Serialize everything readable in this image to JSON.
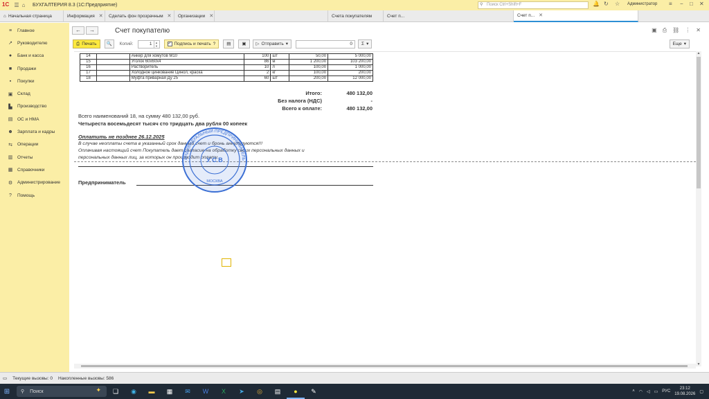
{
  "app": {
    "logo_text": "1С",
    "title": "БУХГАЛТЕРИЯ 8.3  (1С:Предприятие)",
    "search_placeholder": "Поиск Ctrl+Shift+F",
    "notifications_count": "1",
    "user": "Администратор"
  },
  "tabs": [
    {
      "label": "Начальная страница",
      "closable": false
    },
    {
      "label": "Информация",
      "closable": true
    },
    {
      "label": "Сделать фон прозрачным",
      "closable": true
    },
    {
      "label": "Организации",
      "closable": true
    },
    {
      "label": "",
      "closable": false
    },
    {
      "label": "Счета покупателям",
      "closable": false
    },
    {
      "label": "Счет п...",
      "closable": false
    },
    {
      "label": "",
      "closable": false
    },
    {
      "label": "Счет п...",
      "closable": true
    }
  ],
  "sidebar": {
    "items": [
      {
        "label": "Главное",
        "icon": "menu-icon"
      },
      {
        "label": "Руководителю",
        "icon": "chart-icon"
      },
      {
        "label": "Банк и касса",
        "icon": "bank-icon"
      },
      {
        "label": "Продажи",
        "icon": "cart-icon"
      },
      {
        "label": "Покупки",
        "icon": "basket-icon"
      },
      {
        "label": "Склад",
        "icon": "box-icon"
      },
      {
        "label": "Производство",
        "icon": "factory-icon"
      },
      {
        "label": "ОС и НМА",
        "icon": "building-icon"
      },
      {
        "label": "Зарплата и кадры",
        "icon": "people-icon"
      },
      {
        "label": "Операции",
        "icon": "operations-icon"
      },
      {
        "label": "Отчеты",
        "icon": "report-icon"
      },
      {
        "label": "Справочники",
        "icon": "book-icon"
      },
      {
        "label": "Администрирование",
        "icon": "gear-icon"
      },
      {
        "label": "Помощь",
        "icon": "help-icon"
      }
    ]
  },
  "document": {
    "title": "Счет покупателю",
    "toolbar": {
      "print_label": "Печать",
      "copies_label": "Копий:",
      "copies_value": "1",
      "sign_label": "Подпись и печать",
      "sign_checked": true,
      "send_label": "Отправить",
      "sum_value": "0",
      "more_label": "Еще"
    },
    "rows": [
      {
        "n": "14",
        "name": "Анкер для хомутов М10",
        "qty": "100",
        "unit": "шт",
        "price": "50,00",
        "total": "5 000,00"
      },
      {
        "n": "15",
        "name": "Уголок 60х60х4",
        "qty": "86",
        "unit": "м",
        "price": "1 200,00",
        "total": "103 200,00"
      },
      {
        "n": "16",
        "name": "Растворитель",
        "qty": "10",
        "unit": "л",
        "price": "100,00",
        "total": "1 000,00"
      },
      {
        "n": "17",
        "name": "Холодное цинкование Цинол, краска",
        "qty": "2",
        "unit": "кг",
        "price": "100,00",
        "total": "200,00"
      },
      {
        "n": "18",
        "name": "Муфта приварная Ду 25",
        "qty": "60",
        "unit": "шт",
        "price": "200,00",
        "total": "12 000,00"
      }
    ],
    "totals": {
      "itogo_label": "Итого:",
      "itogo_value": "480 132,00",
      "nds_label": "Без налога (НДС)",
      "nds_value": "-",
      "pay_label": "Всего к оплате:",
      "pay_value": "480 132,00"
    },
    "summary_line": "Всего наименований 18, на сумму 480 132,00 руб.",
    "amount_words": "Четыреста восемьдесят тысяч сто тридцать два рубля 00 копеек",
    "deadline": "Оплатить не позднее 26.12.2025",
    "notice_1": "В случае неоплаты счета в указанный срок данный счет и бронь аннулируются!!!",
    "notice_2": "Оплачивая настоящий счет Покупатель дает согласие на обработку своих персональных данных и",
    "notice_3": "персональных данных лиц, за которых он производит оплату.",
    "signer_label": "Предприниматель",
    "stamp_text": "ИНДИВИДУАЛЬНЫЙ ПРЕДПРИНИМАТЕЛЬ",
    "stamp_center": "У С В",
    "stamp_city": "МОСКВА"
  },
  "statusbar": {
    "current_calls": "Текущие вызовы: 0",
    "accumulated_calls": "Накопленные вызовы: 586"
  },
  "taskbar": {
    "search_label": "Поиск",
    "lang": "РУС",
    "time": "23:12",
    "date": "19.08.2026"
  }
}
